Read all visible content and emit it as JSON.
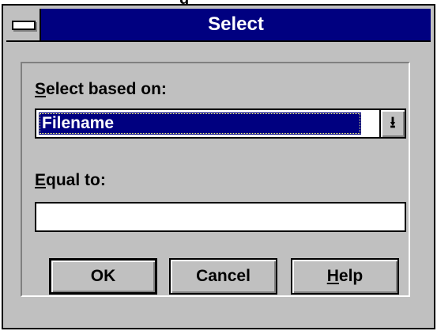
{
  "window": {
    "title": "Select"
  },
  "form": {
    "based_on_label_key": "S",
    "based_on_label_rest": "elect based on:",
    "based_on_value": "Filename",
    "equal_to_label_key": "E",
    "equal_to_label_rest": "qual to:",
    "equal_to_value": ""
  },
  "buttons": {
    "ok": "OK",
    "cancel": "Cancel",
    "help_key": "H",
    "help_rest": "elp"
  },
  "icons": {
    "system_menu": "system-menu-icon",
    "dropdown": "dropdown-arrow-icon"
  }
}
